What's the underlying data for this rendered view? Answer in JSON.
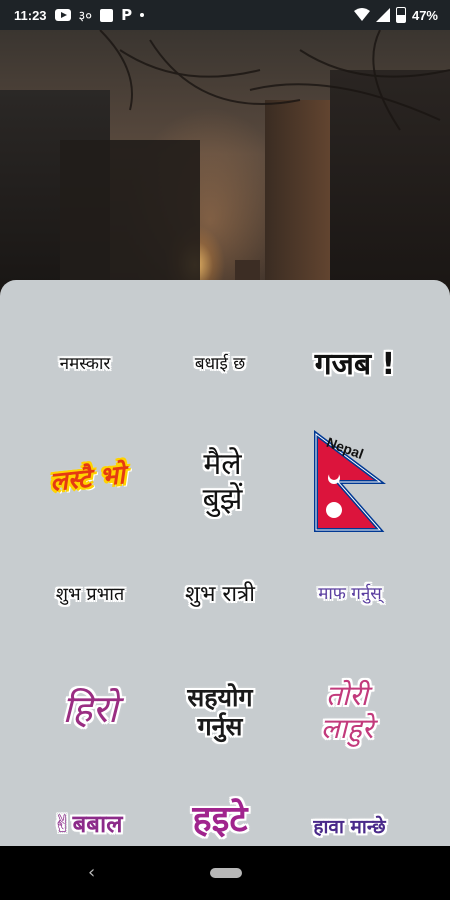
{
  "status_bar": {
    "time": "11:23",
    "notification_icons": [
      "youtube-icon",
      "temperature-icon",
      "image-icon",
      "parking-icon",
      "dot-icon"
    ],
    "temp_text": "३०",
    "p_text": "P",
    "battery_percent": "47%"
  },
  "stickers": [
    {
      "id": "namaskar",
      "text": "नमस्कार"
    },
    {
      "id": "badhai-chha",
      "text": "बधाई छ"
    },
    {
      "id": "gajab",
      "text": "गजब !"
    },
    {
      "id": "lastai-bho",
      "text": "लस्टै भो"
    },
    {
      "id": "maile-bujhe",
      "line1": "मैले",
      "line2": "बुझें"
    },
    {
      "id": "nepal-flag",
      "text": "Nepal"
    },
    {
      "id": "shubha-prabhat",
      "text": "शुभ प्रभात"
    },
    {
      "id": "shubha-ratri",
      "text": "शुभ रात्री"
    },
    {
      "id": "maaf-garnus",
      "text": "माफ गर्नुस्"
    },
    {
      "id": "hiro",
      "text": "हिरो"
    },
    {
      "id": "sahayog-garnus",
      "line1": "सहयोग",
      "line2": "गर्नुस"
    },
    {
      "id": "tori-lahure",
      "line1": "तोरी",
      "line2": "लाहुरे"
    },
    {
      "id": "babal",
      "text": "✌बबाल"
    },
    {
      "id": "haite",
      "text": "हइटे"
    },
    {
      "id": "hawa-manchhe",
      "text": "हावा मान्छे"
    }
  ],
  "colors": {
    "sheet_background": "#c7cccf",
    "flag_red": "#dc143c",
    "flag_blue": "#003893"
  },
  "nav_bar": {
    "back_glyph": "‹"
  }
}
